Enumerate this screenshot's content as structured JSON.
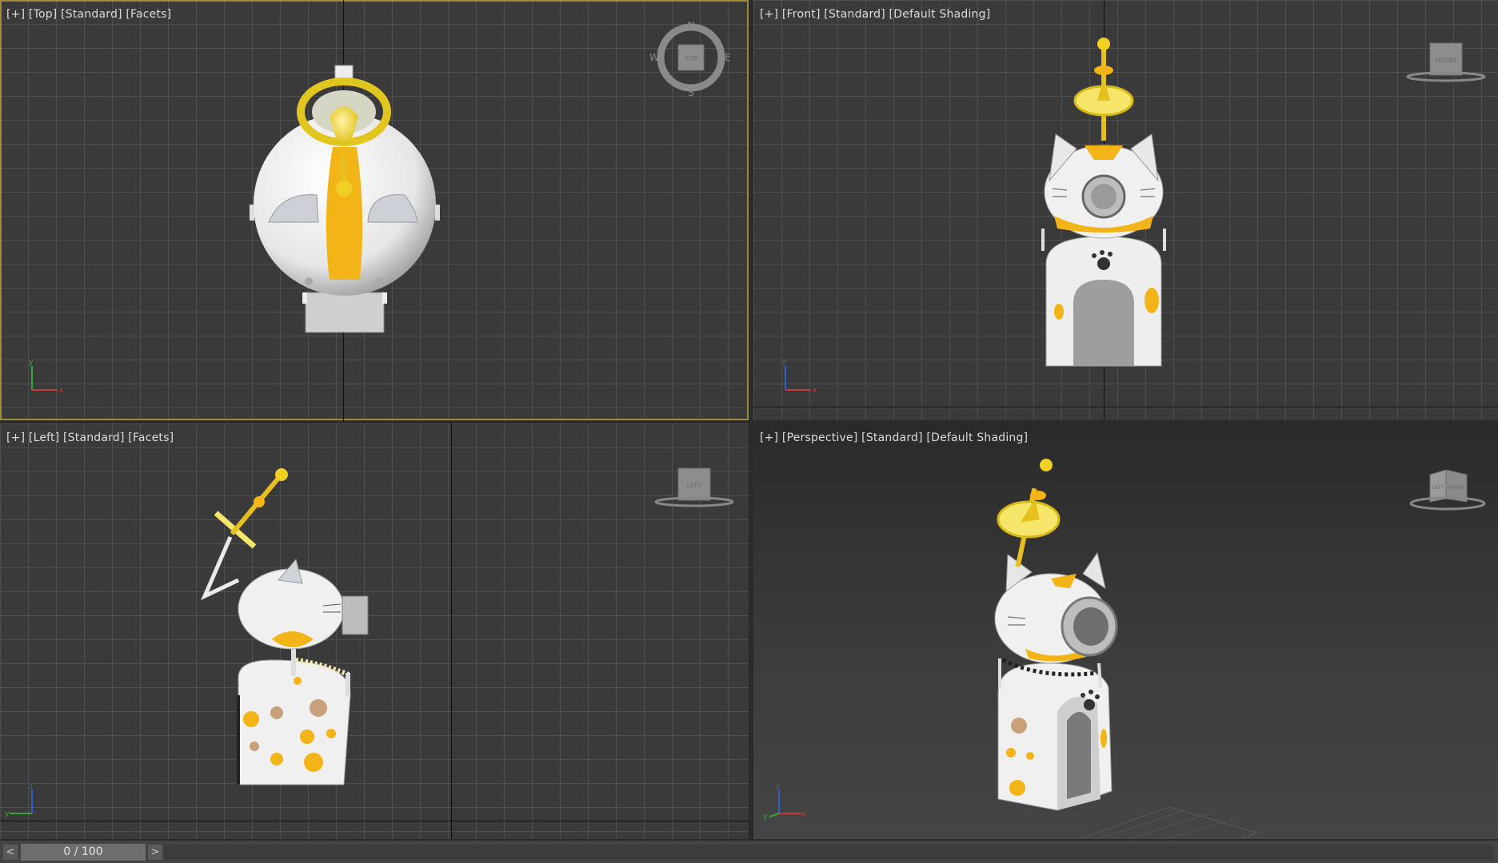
{
  "viewports": {
    "top": {
      "label": "[+] [Top] [Standard] [Facets]",
      "navcube": {
        "face": "TOP",
        "n": "N",
        "s": "S",
        "e": "E",
        "w": "W"
      },
      "axes": {
        "v": "y",
        "h": "x"
      }
    },
    "front": {
      "label": "[+] [Front] [Standard] [Default Shading]",
      "navcube": {
        "face": "FRONT"
      },
      "axes": {
        "v": "z",
        "h": "x"
      }
    },
    "left": {
      "label": "[+] [Left] [Standard] [Facets]",
      "navcube": {
        "face": "LEFT"
      },
      "axes": {
        "v": "z",
        "h": "y"
      }
    },
    "perspective": {
      "label": "[+] [Perspective] [Standard] [Default Shading]",
      "navcube": {
        "face_left": "LEFT",
        "face_right": "FRONT"
      },
      "axes": {
        "v": "z",
        "h": "x",
        "h2": "y"
      }
    }
  },
  "timeline": {
    "prev": "<",
    "next": ">",
    "frame": "0 / 100"
  },
  "colors": {
    "accent_yellow": "#f2b416",
    "active_border": "#a08a3c"
  }
}
